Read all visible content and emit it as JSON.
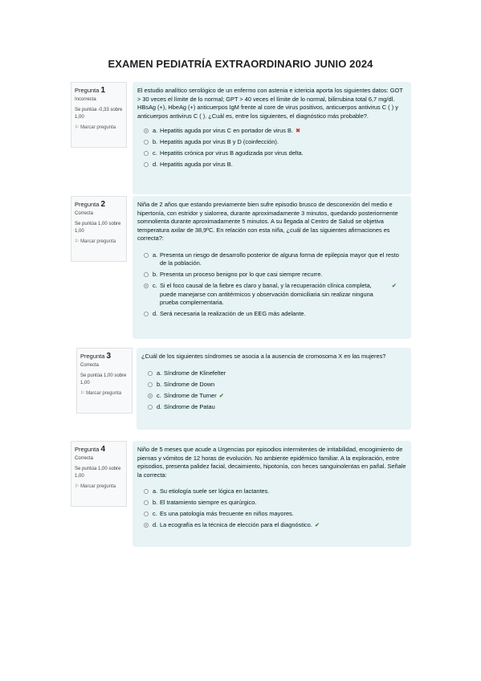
{
  "page_title": "EXAMEN PEDIATRÍA EXTRAORDINARIO JUNIO 2024",
  "questions": [
    {
      "label": "Pregunta",
      "number": "1",
      "state": "Incorrecta",
      "score": "Se puntúa -0,33 sobre 1,00",
      "flag": "Marcar pregunta",
      "text": "El estudio analítico serológico de un enfermo con astenia e ictericia aporta los siguientes datos: GOT > 30 veces el límite de lo normal; GPT > 40 veces el límite de lo normal, bilirrubina total 6,7 mg/dl. HBsAg (+), HbeAg (+) anticuerpos IgM frente al core de virus positivos, anticuerpos antivirus C ( ) y anticuerpos antivirus C ( ). ¿Cuál es, entre los siguientes, el diagnóstico más probable?.",
      "answers": [
        {
          "letter": "a.",
          "text": "Hepatitis aguda por virus C en portador de virus B.",
          "selected": true,
          "mark": "✖"
        },
        {
          "letter": "b.",
          "text": "Hepatitis aguda por virus B y D (coinfección).",
          "selected": false,
          "mark": ""
        },
        {
          "letter": "c.",
          "text": "Hepatitis crónica por virus B agudizada por virus delta.",
          "selected": false,
          "mark": ""
        },
        {
          "letter": "d.",
          "text": "Hepatitis aguda por virus B.",
          "selected": false,
          "mark": ""
        }
      ]
    },
    {
      "label": "Pregunta",
      "number": "2",
      "state": "Correcta",
      "score": "Se puntúa 1,00 sobre 1,00",
      "flag": "Marcar pregunta",
      "text": "Niña de 2 años que estando previamente bien sufre episodio brusco de desconexión del medio e hipertonía, con estridor y sialorrea, durante aproximadamente 3 minutos, quedando posteriormente somnolienta durante aproximadamente 5 minutos. A su llegada al Centro de Salud se objetiva temperatura axilar de 38,9ºC. En relación con esta niña, ¿cuál de las siguientes afirmaciones es correcta?:",
      "answers": [
        {
          "letter": "a.",
          "text": "Presenta un riesgo de desarrollo posterior de alguna forma de epilepsia mayor que el resto de la población.",
          "selected": false,
          "mark": ""
        },
        {
          "letter": "b.",
          "text": "Presenta un proceso benigno por lo que casi siempre recurre.",
          "selected": false,
          "mark": ""
        },
        {
          "letter": "c.",
          "text": "Si el foco causal de la fiebre es claro y banal, y la recuperación clínica completa, puede manejarse con antitérmicos y observación domiciliaria sin realizar ninguna prueba complementaria.",
          "selected": true,
          "mark": "✔"
        },
        {
          "letter": "d.",
          "text": "Será necesaria la realización de un EEG más adelante.",
          "selected": false,
          "mark": ""
        }
      ]
    },
    {
      "label": "Pregunta",
      "number": "3",
      "state": "Correcta",
      "score": "Se puntúa 1,00 sobre 1,00",
      "flag": "Marcar pregunta",
      "text": "¿Cuál de los siguientes síndromes se asocia a la ausencia de cromosoma X en las mujeres?",
      "answers": [
        {
          "letter": "a.",
          "text": "Síndrome de Klinefelter",
          "selected": false,
          "mark": ""
        },
        {
          "letter": "b.",
          "text": "Síndrome de Down",
          "selected": false,
          "mark": ""
        },
        {
          "letter": "c.",
          "text": "Síndrome de Turner",
          "selected": true,
          "mark": "✔"
        },
        {
          "letter": "d.",
          "text": "Síndrome de Patau",
          "selected": false,
          "mark": ""
        }
      ]
    },
    {
      "label": "Pregunta",
      "number": "4",
      "state": "Correcta",
      "score": "Se puntúa 1,00 sobre 1,00",
      "flag": "Marcar pregunta",
      "text": "Niño de 5 meses que acude a Urgencias por episodios intermitentes de irritabilidad, encogimiento de piernas y vómitos de 12 horas de evolución. No ambiente epidémico familiar. A la exploración, entre episodios, presenta palidez facial, decaimiento, hipotonía, con heces sanguinolentas en pañal. Señale la correcta:",
      "answers": [
        {
          "letter": "a.",
          "text": "Su etiología suele ser lógica en lactantes.",
          "selected": false,
          "mark": ""
        },
        {
          "letter": "b.",
          "text": "El tratamiento siempre es quirúrgico.",
          "selected": false,
          "mark": ""
        },
        {
          "letter": "c.",
          "text": "Es una patología más frecuente en niños mayores.",
          "selected": false,
          "mark": ""
        },
        {
          "letter": "d.",
          "text": "La ecografía es la técnica de elección para el diagnóstico.",
          "selected": true,
          "mark": "✔"
        }
      ]
    }
  ]
}
